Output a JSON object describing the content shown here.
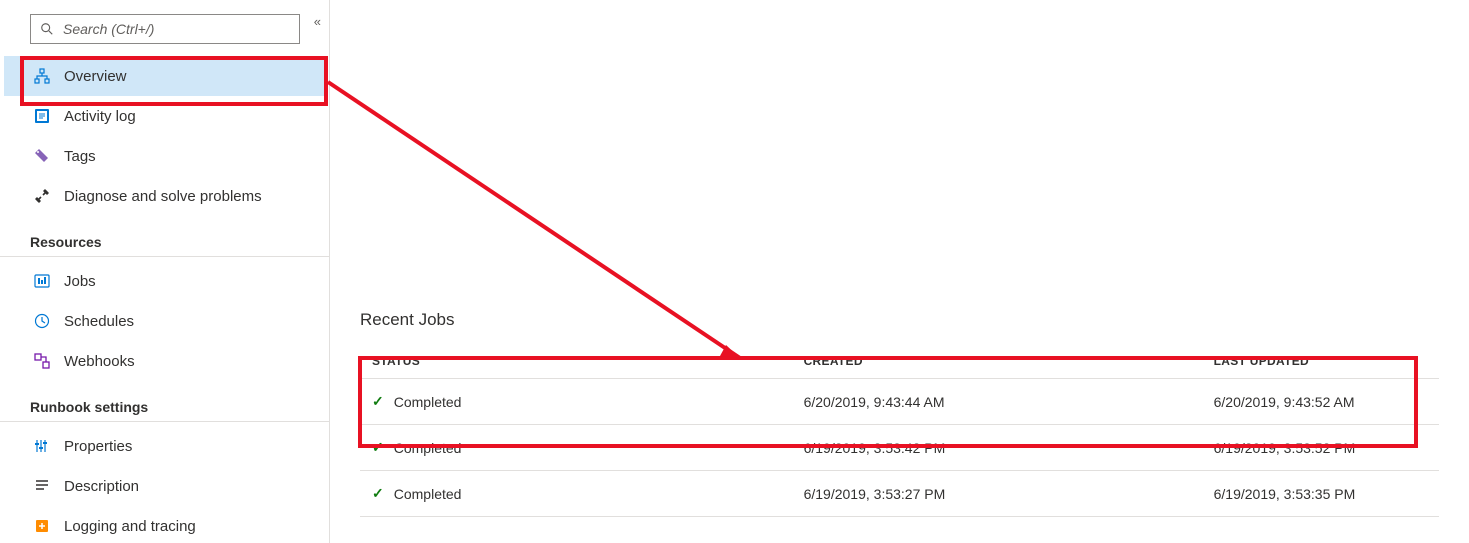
{
  "search": {
    "placeholder": "Search (Ctrl+/)"
  },
  "nav": {
    "items": [
      {
        "label": "Overview"
      },
      {
        "label": "Activity log"
      },
      {
        "label": "Tags"
      },
      {
        "label": "Diagnose and solve problems"
      }
    ],
    "resources_header": "Resources",
    "resources": [
      {
        "label": "Jobs"
      },
      {
        "label": "Schedules"
      },
      {
        "label": "Webhooks"
      }
    ],
    "runbook_header": "Runbook settings",
    "runbook": [
      {
        "label": "Properties"
      },
      {
        "label": "Description"
      },
      {
        "label": "Logging and tracing"
      }
    ]
  },
  "main": {
    "recent_jobs_title": "Recent Jobs",
    "columns": {
      "status": "STATUS",
      "created": "CREATED",
      "updated": "LAST UPDATED"
    },
    "rows": [
      {
        "status": "Completed",
        "created": "6/20/2019, 9:43:44 AM",
        "updated": "6/20/2019, 9:43:52 AM"
      },
      {
        "status": "Completed",
        "created": "6/19/2019, 3:53:42 PM",
        "updated": "6/19/2019, 3:53:52 PM"
      },
      {
        "status": "Completed",
        "created": "6/19/2019, 3:53:27 PM",
        "updated": "6/19/2019, 3:53:35 PM"
      }
    ]
  }
}
